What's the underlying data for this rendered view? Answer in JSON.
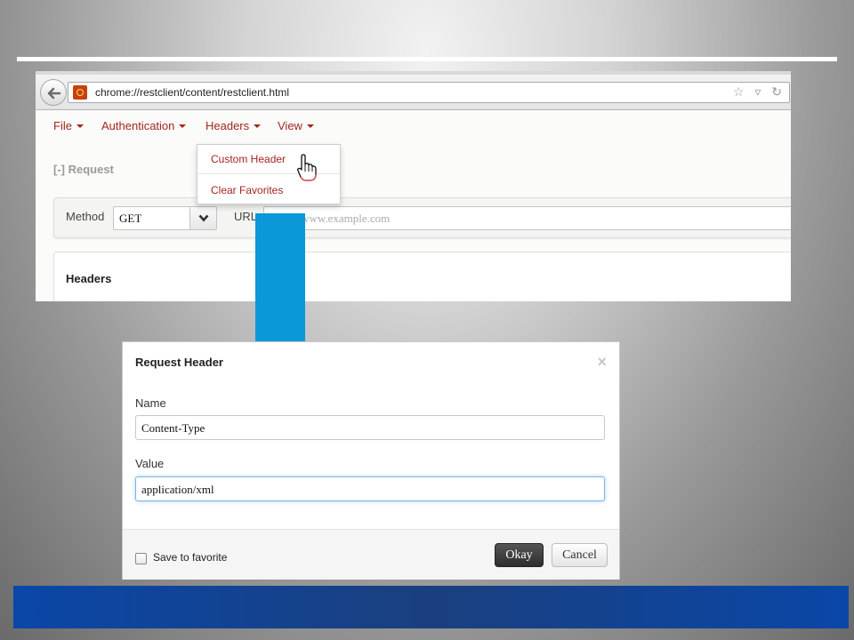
{
  "browser": {
    "url": "chrome://restclient/content/restclient.html",
    "url_icons": "☆ ▿ ↻"
  },
  "menubar": {
    "items": [
      {
        "label": "File"
      },
      {
        "label": "Authentication"
      },
      {
        "label": "Headers"
      },
      {
        "label": "View"
      }
    ]
  },
  "dropdown": {
    "items": [
      {
        "label": "Custom Header"
      },
      {
        "label": "Clear Favorites"
      }
    ]
  },
  "request": {
    "section_title": "[-] Request",
    "method_label": "Method",
    "method_value": "GET",
    "url_label": "URL",
    "url_placeholder": "http://www.example.com"
  },
  "headers_panel": {
    "title": "Headers"
  },
  "modal": {
    "title": "Request Header",
    "close": "×",
    "name_label": "Name",
    "name_value": "Content-Type",
    "value_label": "Value",
    "value_value": "application/xml",
    "save_favorite_label": "Save to favorite",
    "okay_label": "Okay",
    "cancel_label": "Cancel"
  },
  "colors": {
    "menu_text": "#a3261e",
    "arrow": "#0a98d8",
    "band": "#0a47a8"
  },
  "icons": [
    "back-arrow-icon",
    "site-favicon-icon",
    "star-icon",
    "dropdown-icon",
    "reload-icon",
    "caret-down-icon",
    "hand-pointer-icon",
    "chevron-down-icon",
    "close-icon",
    "down-arrow-icon"
  ]
}
